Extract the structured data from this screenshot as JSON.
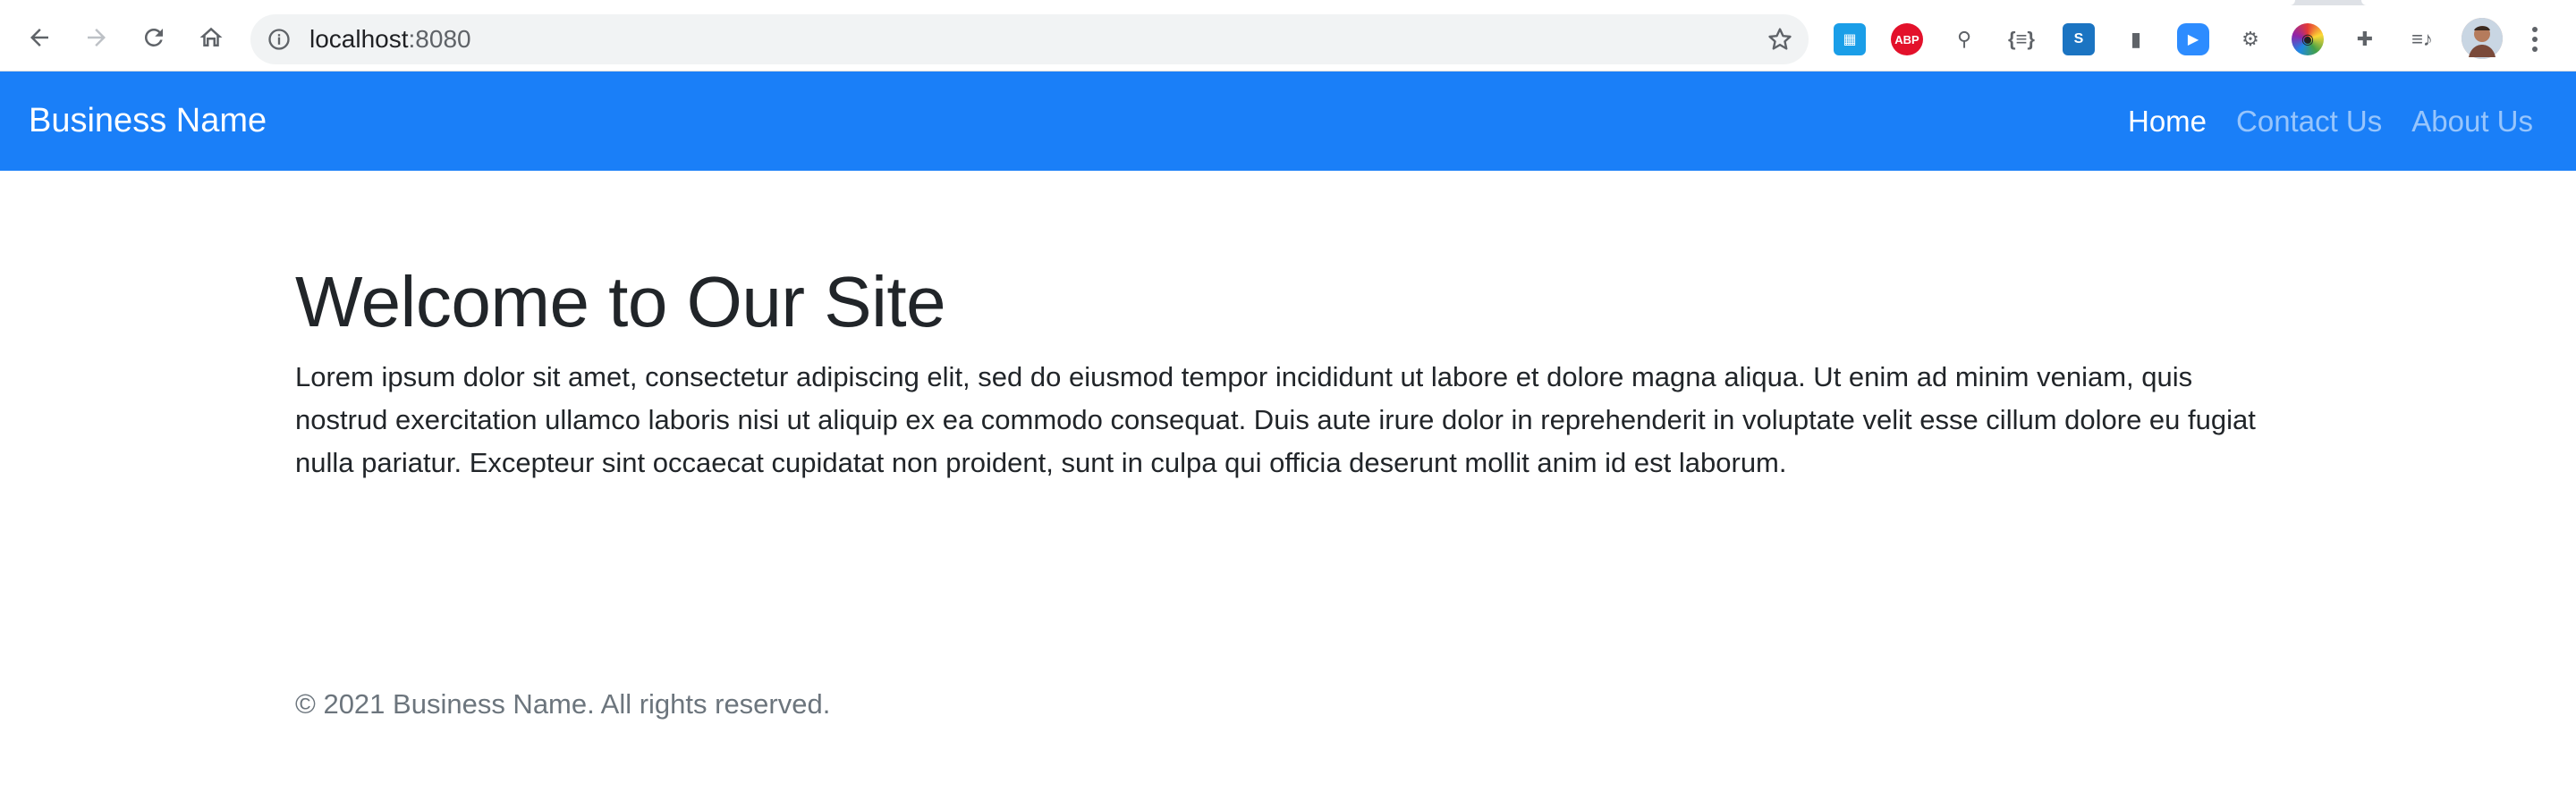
{
  "browser": {
    "url_host": "localhost",
    "url_port": ":8080",
    "extensions": [
      {
        "name": "table-extension-icon",
        "color": "#1a9ee8",
        "glyph": "▦"
      },
      {
        "name": "adblock-plus-icon",
        "color": "#e3112b",
        "glyph": "ABP"
      },
      {
        "name": "sitemap-extension-icon",
        "color": "#ffffff",
        "glyph": "⚲"
      },
      {
        "name": "json-viewer-icon",
        "color": "#ffffff",
        "glyph": "{≡}"
      },
      {
        "name": "s-extension-icon",
        "color": "#1b74c2",
        "glyph": "S"
      },
      {
        "name": "bookmark-extension-icon",
        "color": "#ffffff",
        "glyph": "▮"
      },
      {
        "name": "zoom-extension-icon",
        "color": "#2d8cff",
        "glyph": "▶"
      },
      {
        "name": "gear-extension-icon",
        "color": "#ffffff",
        "glyph": "⚙"
      },
      {
        "name": "color-picker-icon",
        "color": "#ffffff",
        "glyph": "◉"
      },
      {
        "name": "puzzle-extensions-icon",
        "color": "#ffffff",
        "glyph": "✚"
      },
      {
        "name": "media-control-icon",
        "color": "#ffffff",
        "glyph": "≡♪"
      }
    ]
  },
  "navbar": {
    "brand": "Business Name",
    "links": [
      {
        "label": "Home",
        "active": true
      },
      {
        "label": "Contact Us",
        "active": false
      },
      {
        "label": "About Us",
        "active": false
      }
    ]
  },
  "main": {
    "title": "Welcome to Our Site",
    "body": "Lorem ipsum dolor sit amet, consectetur adipiscing elit, sed do eiusmod tempor incididunt ut labore et dolore magna aliqua. Ut enim ad minim veniam, quis nostrud exercitation ullamco laboris nisi ut aliquip ex ea commodo consequat. Duis aute irure dolor in reprehenderit in voluptate velit esse cillum dolore eu fugiat nulla pariatur. Excepteur sint occaecat cupidatat non proident, sunt in culpa qui officia deserunt mollit anim id est laborum."
  },
  "footer": {
    "text": "© 2021 Business Name. All rights reserved."
  },
  "colors": {
    "navbar_bg": "#1a7ff8",
    "nav_link_active": "#ffffff",
    "nav_link_muted": "rgba(255,255,255,0.55)",
    "footer_text": "#6c757d"
  }
}
